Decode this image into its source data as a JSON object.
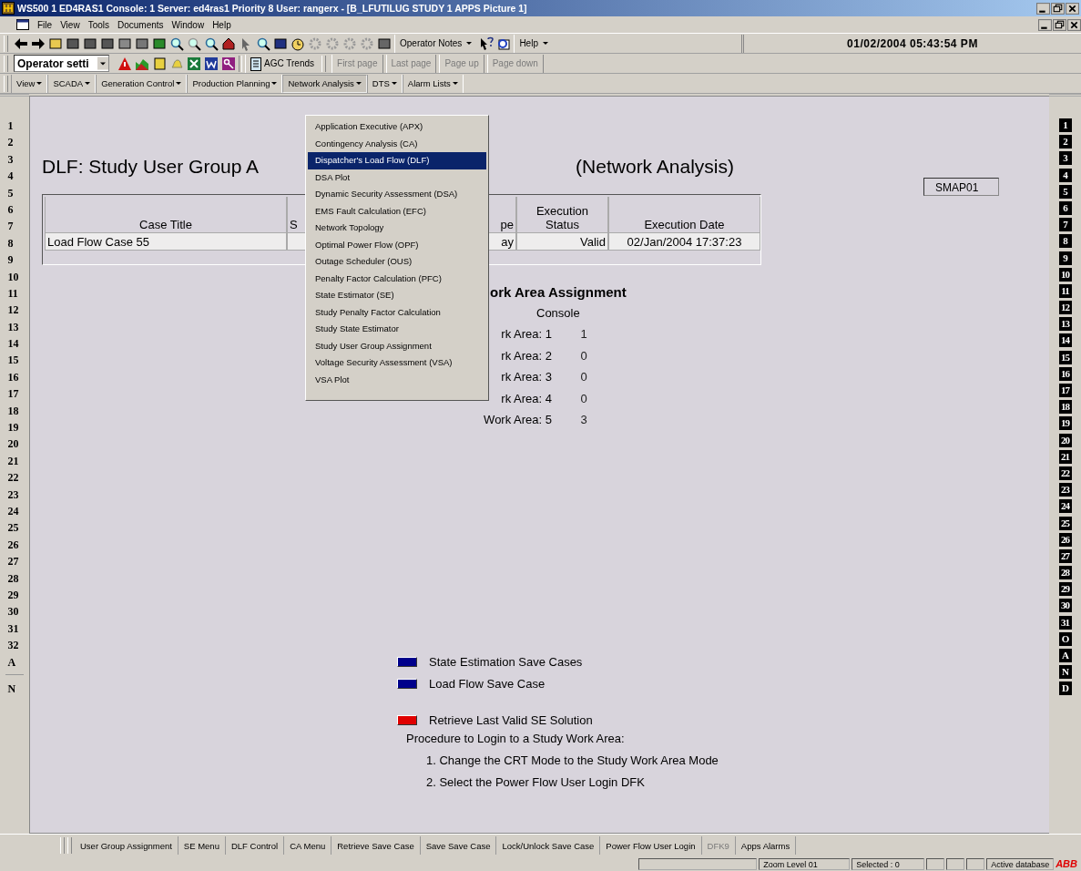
{
  "window": {
    "title": "WS500 1 ED4RAS1  Console: 1  Server: ed4ras1  Priority 8  User: rangerx  - [B_LFUTILUG  STUDY 1 APPS  Picture 1]"
  },
  "menu_bar": [
    "File",
    "View",
    "Tools",
    "Documents",
    "Window",
    "Help"
  ],
  "toolbar": {
    "buttons": [
      "Operator Notes",
      "Help"
    ],
    "clock": "01/02/2004 05:43:54 PM"
  },
  "toolbar_2": {
    "combo": "Operator setti",
    "agc_button": "AGC Trends",
    "page_buttons": [
      {
        "label": "First page",
        "disabled": true
      },
      {
        "label": "Last page",
        "disabled": true
      },
      {
        "label": "Page up",
        "disabled": true
      },
      {
        "label": "Page down",
        "disabled": true
      }
    ]
  },
  "menus": [
    {
      "label": "View",
      "selected": false
    },
    {
      "label": "SCADA",
      "selected": false
    },
    {
      "label": "Generation Control",
      "selected": false
    },
    {
      "label": "Production Planning",
      "selected": false
    },
    {
      "label": "Network Analysis",
      "selected": true
    },
    {
      "label": "DTS",
      "selected": false
    },
    {
      "label": "Alarm Lists",
      "selected": false
    }
  ],
  "open_menu": {
    "items": [
      {
        "label": "Application Executive (APX)",
        "selected": false
      },
      {
        "label": "Contingency Analysis (CA)",
        "selected": false
      },
      {
        "label": "Dispatcher's Load Flow (DLF)",
        "selected": true
      },
      {
        "label": "DSA Plot",
        "selected": false
      },
      {
        "label": "Dynamic Security Assessment (DSA)",
        "selected": false
      },
      {
        "label": "EMS Fault Calculation (EFC)",
        "selected": false
      },
      {
        "label": "Network Topology",
        "selected": false
      },
      {
        "label": "Optimal Power Flow (OPF)",
        "selected": false
      },
      {
        "label": "Outage Scheduler (OUS)",
        "selected": false
      },
      {
        "label": "Penalty Factor Calculation (PFC)",
        "selected": false
      },
      {
        "label": "State Estimator (SE)",
        "selected": false
      },
      {
        "label": "Study Penalty Factor Calculation",
        "selected": false
      },
      {
        "label": "Study State Estimator",
        "selected": false
      },
      {
        "label": "Study User Group Assignment",
        "selected": false
      },
      {
        "label": "Voltage Security Assessment (VSA)",
        "selected": false
      },
      {
        "label": "VSA Plot",
        "selected": false
      }
    ]
  },
  "left_strip": [
    "1",
    "2",
    "3",
    "4",
    "5",
    "6",
    "7",
    "8",
    "9",
    "10",
    "11",
    "12",
    "13",
    "14",
    "15",
    "16",
    "17",
    "18",
    "19",
    "20",
    "21",
    "22",
    "23",
    "24",
    "25",
    "26",
    "27",
    "28",
    "29",
    "30",
    "31",
    "32",
    "A",
    "N"
  ],
  "right_strip": [
    "1",
    "2",
    "3",
    "4",
    "5",
    "6",
    "7",
    "8",
    "9",
    "10",
    "11",
    "12",
    "13",
    "14",
    "15",
    "16",
    "17",
    "18",
    "19",
    "20",
    "21",
    "22",
    "23",
    "24",
    "25",
    "26",
    "27",
    "28",
    "29",
    "30",
    "31",
    "O",
    "A",
    "N",
    "D"
  ],
  "display": {
    "title_start": "DLF: Study User Group A",
    "title_end": "(Network Analysis)",
    "station": "SMAP01",
    "table": {
      "columns": [
        "Case Title",
        "S",
        "pe",
        "Execution Status",
        "Execution Date"
      ],
      "rows": [
        [
          "Load Flow Case 55",
          "",
          "ay",
          "Valid",
          "02/Jan/2004 17:37:23"
        ]
      ]
    },
    "assignment": {
      "heading": "ork Area Assignment",
      "column": "Console",
      "rows": [
        {
          "label": "rk Area: 1",
          "value": "1"
        },
        {
          "label": "rk Area: 2",
          "value": "0"
        },
        {
          "label": "rk Area: 3",
          "value": "0"
        },
        {
          "label": "rk Area: 4",
          "value": "0"
        },
        {
          "label": "Work Area: 5",
          "value": "3"
        }
      ]
    },
    "buttons": [
      {
        "label": "State Estimation Save Cases",
        "color": "#00008b"
      },
      {
        "label": "Load Flow Save Case",
        "color": "#00008b"
      },
      {
        "label": "Retrieve Last Valid SE Solution",
        "color": "#e00000"
      }
    ],
    "procedure": {
      "title": "Procedure to Login to a Study Work Area:",
      "steps": [
        "1. Change the CRT Mode to the Study Work Area Mode",
        "2. Select the Power Flow User Login DFK"
      ]
    }
  },
  "bottom_buttons": [
    {
      "label": "User Group Assignment",
      "disabled": false
    },
    {
      "label": "SE Menu",
      "disabled": false
    },
    {
      "label": "DLF Control",
      "disabled": false
    },
    {
      "label": "CA Menu",
      "disabled": false
    },
    {
      "label": "Retrieve Save Case",
      "disabled": false
    },
    {
      "label": "Save Save Case",
      "disabled": false
    },
    {
      "label": "Lock/Unlock  Save Case",
      "disabled": false
    },
    {
      "label": "Power Flow User Login",
      "disabled": false
    },
    {
      "label": "DFK9",
      "disabled": true
    },
    {
      "label": "Apps Alarms",
      "disabled": false
    }
  ],
  "status_bar": {
    "zoom": "Zoom Level 01",
    "selected": "Selected : 0",
    "database": "Active database",
    "logo": "ABB"
  }
}
